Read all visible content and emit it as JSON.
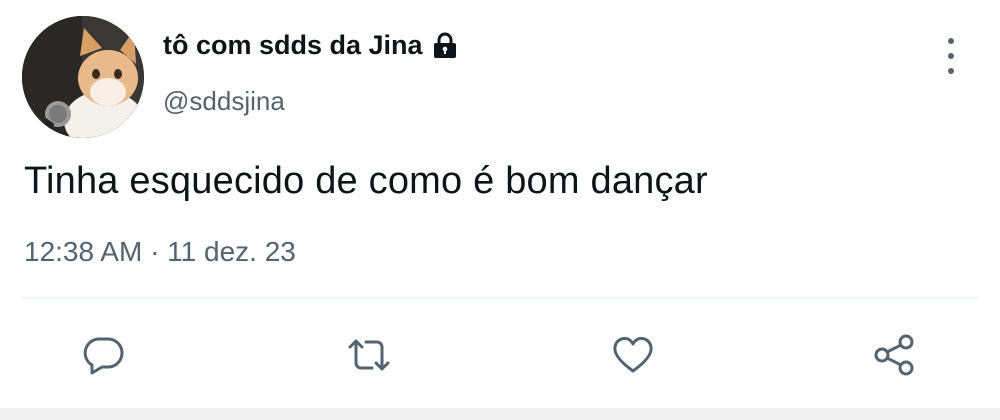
{
  "tweet": {
    "display_name": "tô com sdds da Jina",
    "handle": "@sddsjina",
    "text": "Tinha esquecido de como é bom dançar",
    "timestamp": "12:38 AM · 11 dez. 23",
    "avatar_icon": "cat-with-microphone-avatar",
    "lock_icon": "lock-icon"
  },
  "actions": [
    {
      "name": "reply",
      "icon": "reply-icon"
    },
    {
      "name": "retweet",
      "icon": "retweet-icon"
    },
    {
      "name": "like",
      "icon": "heart-icon"
    },
    {
      "name": "share",
      "icon": "share-icon"
    }
  ],
  "colors": {
    "text": "#0f1419",
    "secondary": "#536471",
    "divider": "#eff3f4"
  }
}
